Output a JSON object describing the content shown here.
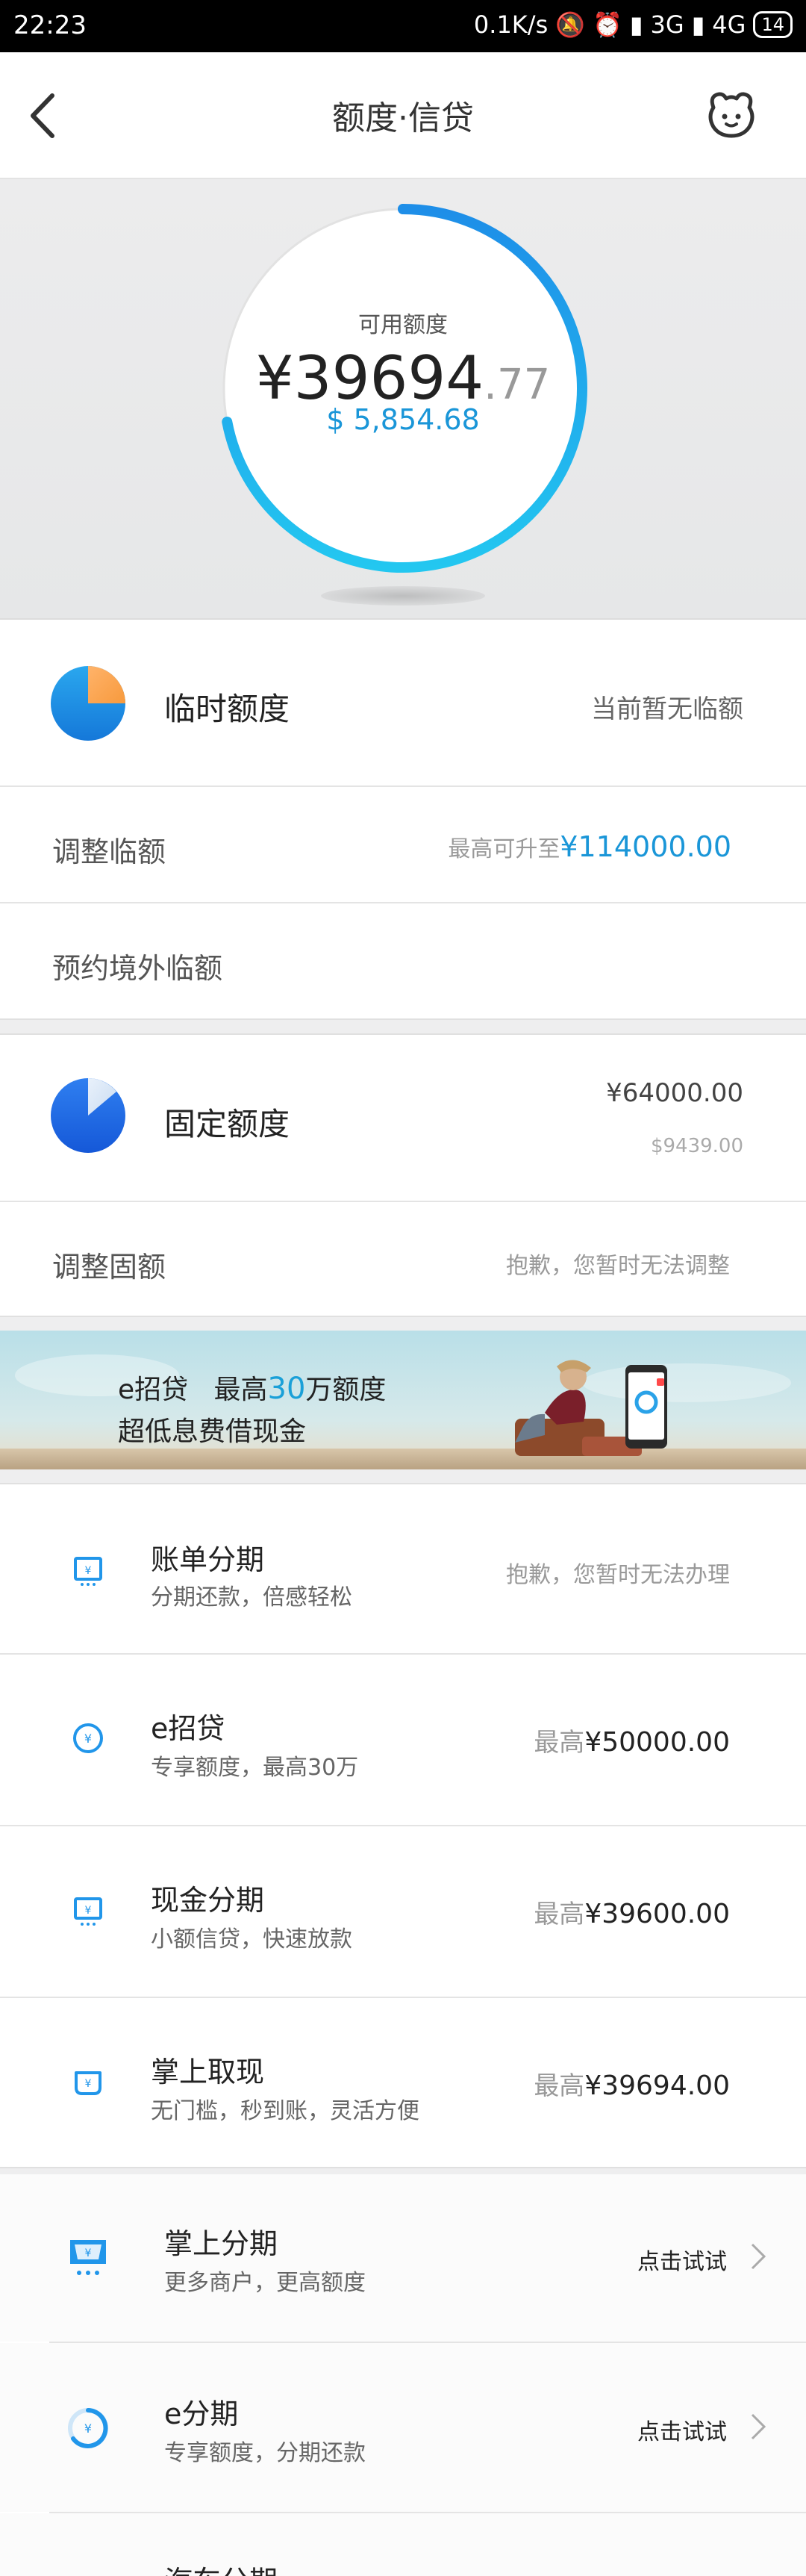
{
  "status_bar": {
    "time": "22:23",
    "right_text": "0.1K/s",
    "net1": "3G",
    "net2": "4G",
    "battery": "14"
  },
  "nav": {
    "title": "额度·信贷",
    "back_icon": "chevron-left-icon",
    "assistant_icon": "robot-face-icon"
  },
  "gauge": {
    "label": "可用额度",
    "amount_int": "¥39694",
    "amount_dec": ".77",
    "usd": "$ 5,854.68",
    "fraction_available": 0.72,
    "colors": {
      "arc_start": "#1e8ee8",
      "arc_end": "#23c7f0",
      "track": "#e2e2e2"
    }
  },
  "temp_quota": {
    "title": "临时额度",
    "status": "当前暂无临额",
    "adjust_label": "调整临额",
    "adjust_prefix": "最高可升至",
    "adjust_amount": "¥114000.00",
    "abroad_label": "预约境外临额",
    "icon": "pie-chart-icon"
  },
  "fixed_quota": {
    "title": "固定额度",
    "amount_cny": "¥64000.00",
    "amount_usd": "$9439.00",
    "adjust_label": "调整固额",
    "adjust_status": "抱歉，您暂时无法调整",
    "icon": "pie-chart-icon"
  },
  "banner": {
    "line1_prefix": "e招贷",
    "line1_mid": "最高",
    "line1_hl": "30",
    "line1_suffix": "万额度",
    "line2": "超低息费借现金"
  },
  "services": [
    {
      "title": "账单分期",
      "sub": "分期还款，倍感轻松",
      "right_pre": "",
      "right": "抱歉，您暂时无法办理",
      "icon": "bill-installment-icon"
    },
    {
      "title": "e招贷",
      "sub": "专享额度，最高30万",
      "right_pre": "最高",
      "right": "¥50000.00",
      "icon": "coin-icon"
    },
    {
      "title": "现金分期",
      "sub": "小额信贷，快速放款",
      "right_pre": "最高",
      "right": "¥39600.00",
      "icon": "cash-installment-icon"
    },
    {
      "title": "掌上取现",
      "sub": "无门槛，秒到账，灵活方便",
      "right_pre": "最高",
      "right": "¥39694.00",
      "icon": "wallet-icon"
    }
  ],
  "installments": [
    {
      "title": "掌上分期",
      "sub": "更多商户，更高额度",
      "cta": "点击试试",
      "icon": "cart-icon"
    },
    {
      "title": "e分期",
      "sub": "专享额度，分期还款",
      "cta": "点击试试",
      "icon": "e-installment-icon"
    },
    {
      "title": "汽车分期",
      "sub": "",
      "cta": "",
      "icon": "car-icon"
    }
  ]
}
